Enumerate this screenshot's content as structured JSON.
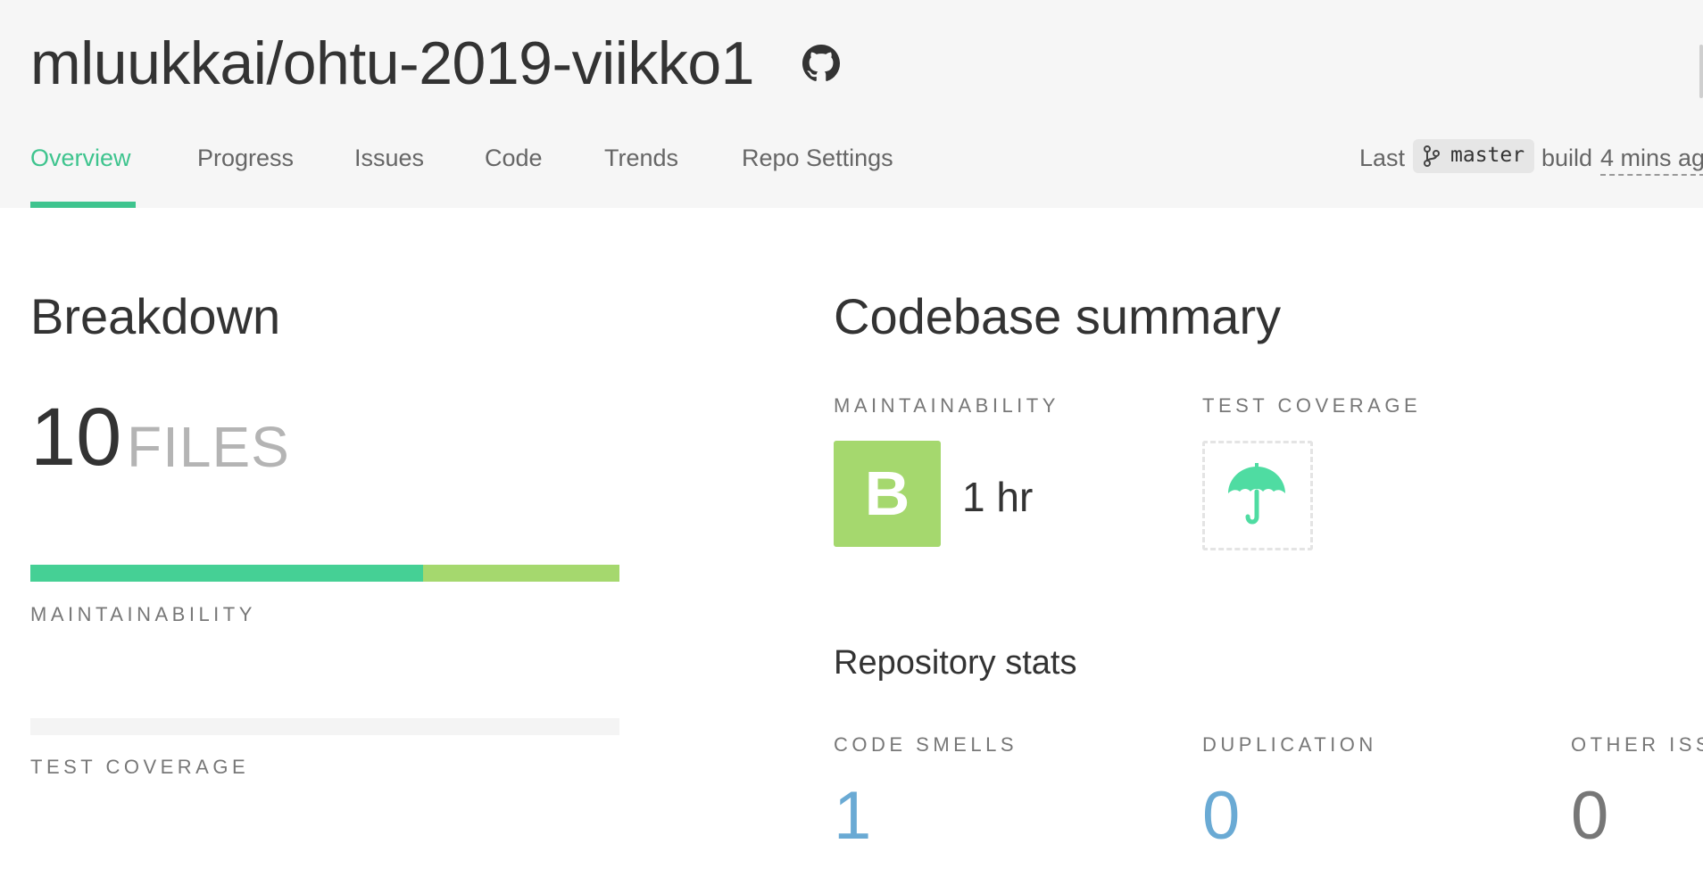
{
  "header": {
    "repo_title": "mluukkai/ohtu-2019-viikko1",
    "repo_icon": "github-icon"
  },
  "nav": {
    "tabs": [
      {
        "label": "Overview",
        "active": true
      },
      {
        "label": "Progress",
        "active": false
      },
      {
        "label": "Issues",
        "active": false
      },
      {
        "label": "Code",
        "active": false
      },
      {
        "label": "Trends",
        "active": false
      },
      {
        "label": "Repo Settings",
        "active": false
      }
    ],
    "last_build": {
      "prefix": "Last",
      "branch_icon": "git-branch-icon",
      "branch": "master",
      "build_word": "build",
      "time": "4 mins ag"
    }
  },
  "breakdown": {
    "title": "Breakdown",
    "file_count": "10",
    "files_label": "FILES",
    "maintainability_label": "MAINTAINABILITY",
    "maintainability_bar": [
      {
        "grade": "A",
        "fraction": 0.667,
        "color": "#45d095"
      },
      {
        "grade": "B",
        "fraction": 0.333,
        "color": "#a5d86e"
      }
    ],
    "test_coverage_label": "TEST COVERAGE",
    "test_coverage_bar_color": "#f4f4f4"
  },
  "summary": {
    "title": "Codebase summary",
    "maintainability_label": "MAINTAINABILITY",
    "grade": "B",
    "grade_color": "#a5d86e",
    "tech_debt": "1 hr",
    "test_coverage_label": "TEST COVERAGE",
    "coverage_icon": "umbrella-icon",
    "stats_title": "Repository stats",
    "stats": [
      {
        "label": "CODE SMELLS",
        "value": "1",
        "color": "#6aaad4"
      },
      {
        "label": "DUPLICATION",
        "value": "0",
        "color": "#6aaad4"
      },
      {
        "label": "OTHER ISS",
        "value": "0",
        "color": "#777777"
      }
    ]
  },
  "colors": {
    "accent": "#3ec48e",
    "header_bg": "#f6f6f6"
  }
}
